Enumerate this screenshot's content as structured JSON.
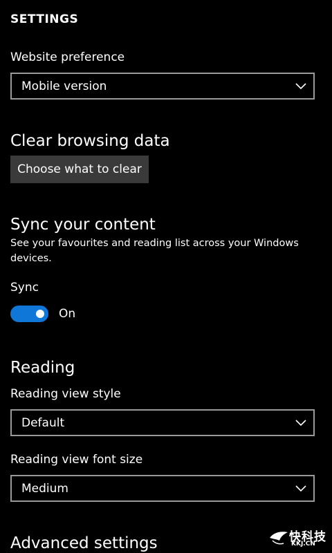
{
  "header": {
    "title": "SETTINGS"
  },
  "website_preference": {
    "label": "Website preference",
    "selected": "Mobile version"
  },
  "clear_browsing": {
    "heading": "Clear browsing data",
    "button_label": "Choose what to clear"
  },
  "sync": {
    "heading": "Sync your content",
    "description": "See your favourites and reading list across your Windows devices.",
    "toggle_label": "Sync",
    "toggle_state": "On",
    "toggle_on": true
  },
  "reading": {
    "heading": "Reading",
    "view_style_label": "Reading view style",
    "view_style_selected": "Default",
    "font_size_label": "Reading view font size",
    "font_size_selected": "Medium"
  },
  "advanced": {
    "heading": "Advanced settings"
  },
  "watermark": {
    "main_text": "快科技",
    "sub_text": "KKJ.CN"
  },
  "colors": {
    "background": "#000000",
    "text": "#ffffff",
    "accent": "#0e77d8",
    "button_bg": "#3a3a3a",
    "combo_border": "#9a9a9a"
  },
  "icons": {
    "dropdown": "chevron-down-icon",
    "watermark": "bird-logo-icon"
  }
}
